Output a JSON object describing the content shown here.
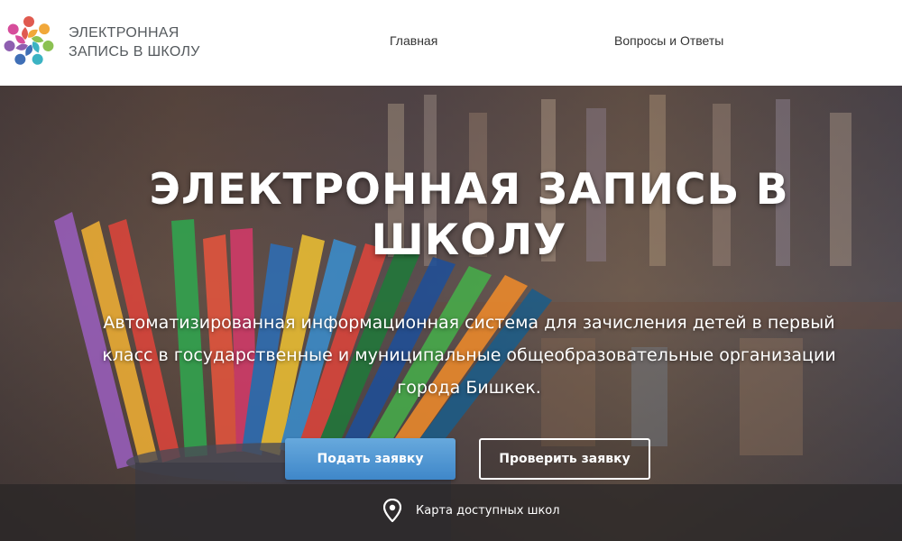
{
  "header": {
    "brand_line1": "ЭЛЕКТРОННАЯ",
    "brand_line2": "ЗАПИСЬ В ШКОЛУ",
    "nav": {
      "home": "Главная",
      "faq": "Вопросы и Ответы"
    }
  },
  "hero": {
    "title": "ЭЛЕКТРОННАЯ ЗАПИСЬ В ШКОЛУ",
    "subtitle": "Автоматизированная информационная система для зачисления детей в первый класс в государственные и муниципальные общеобразовательные организации города Бишкек.",
    "buttons": {
      "apply": "Подать заявку",
      "check": "Проверить заявку"
    },
    "map_link": "Карта доступных школ"
  },
  "colors": {
    "primary_button": "#4a90d0",
    "logo_colors": [
      "#e05a4f",
      "#f1a83a",
      "#8cc152",
      "#3bb3c3",
      "#3f6fb6",
      "#8e5fb0",
      "#d64d9b"
    ]
  },
  "icons": {
    "map_icon": "map-pin-icon"
  }
}
